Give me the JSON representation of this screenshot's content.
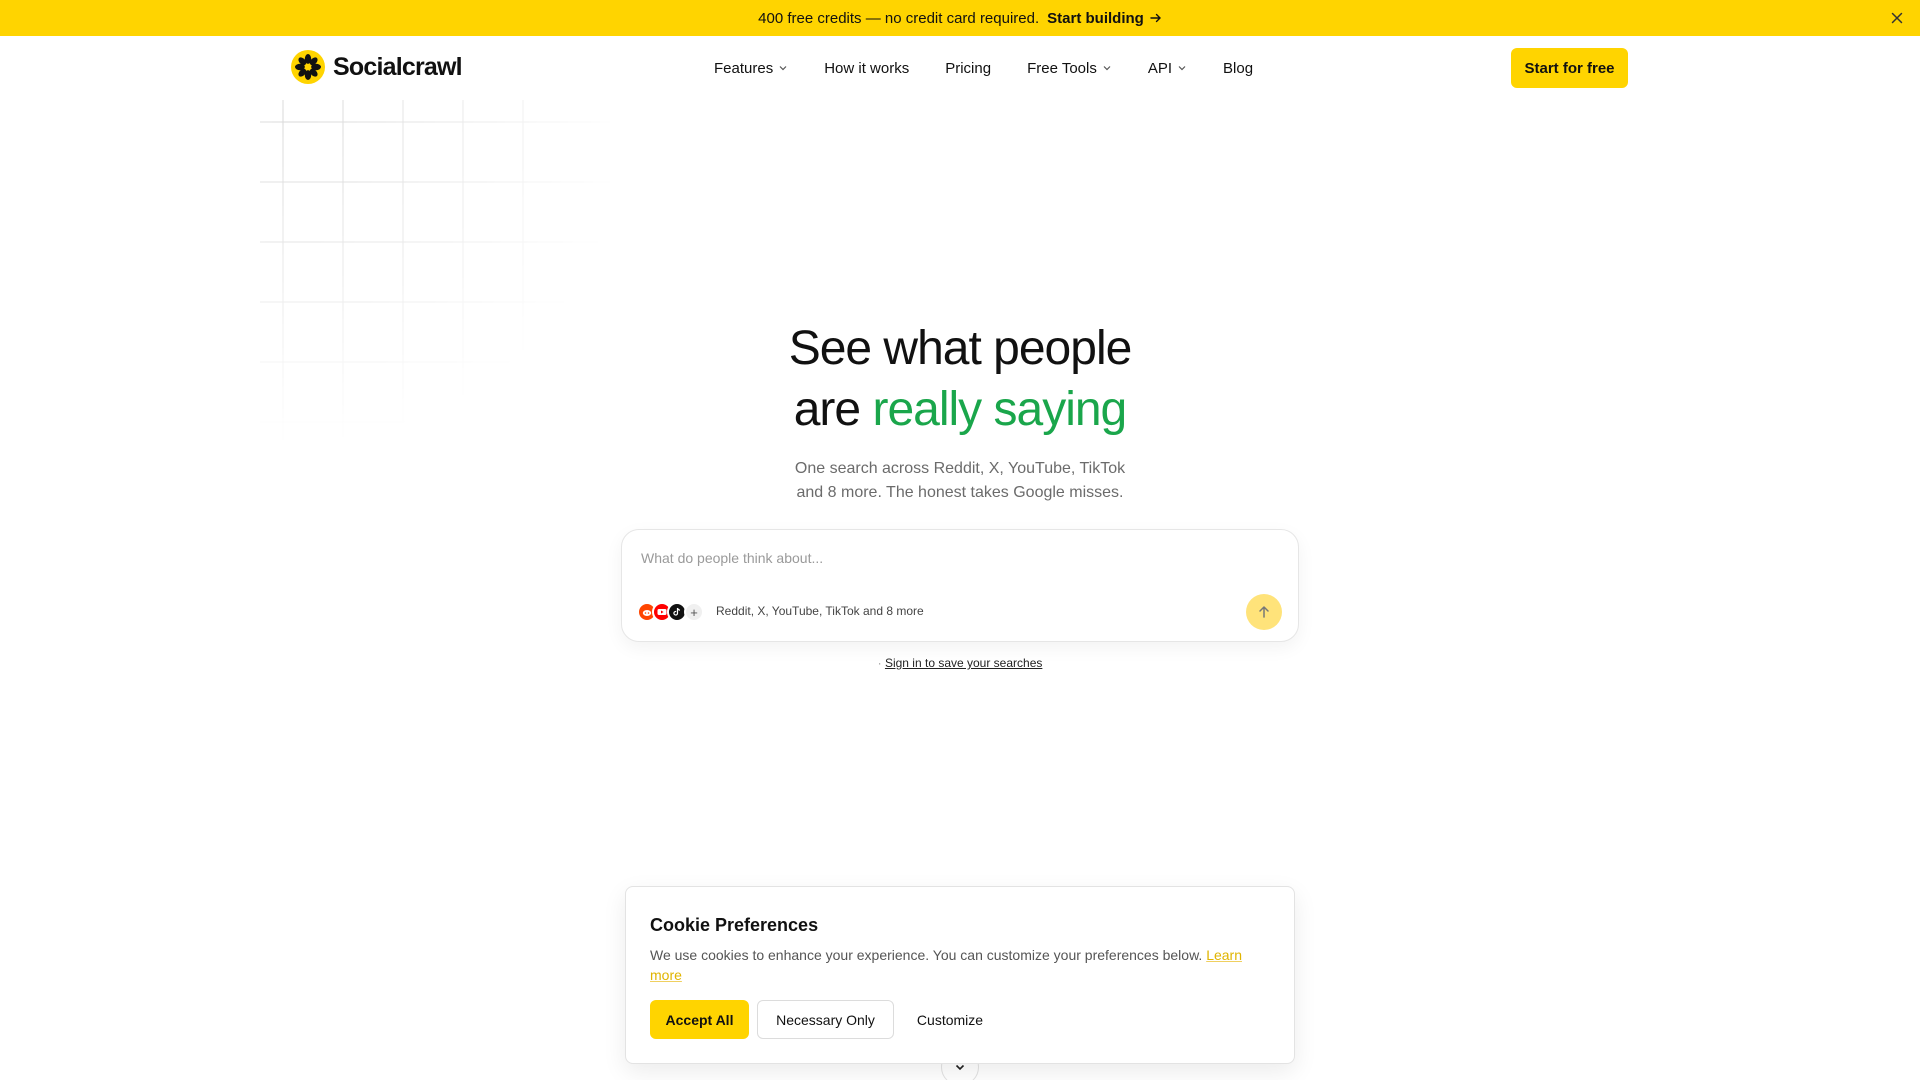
{
  "announcement": {
    "message": "400 free credits — no credit card required.",
    "cta_label": "Start building"
  },
  "nav": {
    "brand": "Socialcrawl",
    "items": [
      {
        "label": "Features",
        "has_dropdown": true
      },
      {
        "label": "How it works",
        "has_dropdown": false
      },
      {
        "label": "Pricing",
        "has_dropdown": false
      },
      {
        "label": "Free Tools",
        "has_dropdown": true
      },
      {
        "label": "API",
        "has_dropdown": true
      },
      {
        "label": "Blog",
        "has_dropdown": false
      }
    ],
    "cta_label": "Start for free"
  },
  "hero": {
    "title_line1": "See what people",
    "title_line2_prefix": "are ",
    "title_line2_accent": "really saying",
    "subtitle_line1": "One search across Reddit, X, YouTube, TikTok",
    "subtitle_line2": "and 8 more. The honest takes Google misses."
  },
  "search": {
    "placeholder": "What do people think about...",
    "value": "",
    "platforms_label": "Reddit, X, YouTube, TikTok and 8 more",
    "platform_icons": [
      "reddit-icon",
      "youtube-icon",
      "tiktok-icon",
      "plus-icon"
    ]
  },
  "signin": {
    "link_label": "Sign in to save your searches"
  },
  "cookie": {
    "title": "Cookie Preferences",
    "text": "We use cookies to enhance your experience. You can customize your preferences below. ",
    "learn_more": "Learn more",
    "accept_label": "Accept All",
    "necessary_label": "Necessary Only",
    "customize_label": "Customize"
  },
  "colors": {
    "brand_yellow": "#ffd400",
    "accent_green": "#1aa64b",
    "reddit": "#ff4500",
    "youtube": "#ff0000",
    "tiktok": "#111111"
  }
}
